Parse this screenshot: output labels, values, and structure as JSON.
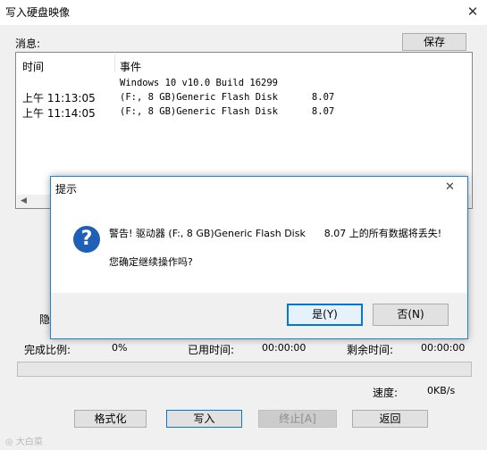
{
  "window": {
    "title": "写入硬盘映像",
    "close_glyph": "✕"
  },
  "messages": {
    "label": "消息:",
    "save_label": "保存",
    "columns": {
      "time": "时间",
      "event": "事件"
    },
    "rows": [
      {
        "time": "",
        "event": "Windows 10 v10.0 Build 16299"
      },
      {
        "time": "上午 11:13:05",
        "event": "(F:, 8 GB)Generic Flash Disk      8.07"
      },
      {
        "time": "上午 11:14:05",
        "event": "(F:, 8 GB)Generic Flash Disk      8.07"
      }
    ]
  },
  "hidden_label_fragment": "隐",
  "progress": {
    "percent_label": "完成比例:",
    "percent_value": "0%",
    "fraction": 0,
    "elapsed_label": "已用时间:",
    "elapsed_value": "00:00:00",
    "remaining_label": "剩余时间:",
    "remaining_value": "00:00:00",
    "speed_label": "速度:",
    "speed_value": "0KB/s"
  },
  "buttons": {
    "format": "格式化",
    "write": "写入",
    "stop": "终止[A]",
    "back": "返回"
  },
  "watermark": "大白菜",
  "dialog": {
    "title": "提示",
    "close_glyph": "✕",
    "icon_glyph": "?",
    "warning": "警告! 驱动器 (F:, 8 GB)Generic Flash Disk      8.07 上的所有数据将丢失!",
    "question": "您确定继续操作吗?",
    "yes_label": "是(Y)",
    "no_label": "否(N)"
  },
  "colors": {
    "accent": "#0078d7",
    "progress": "#06b025",
    "icon": "#1f5fb5"
  }
}
